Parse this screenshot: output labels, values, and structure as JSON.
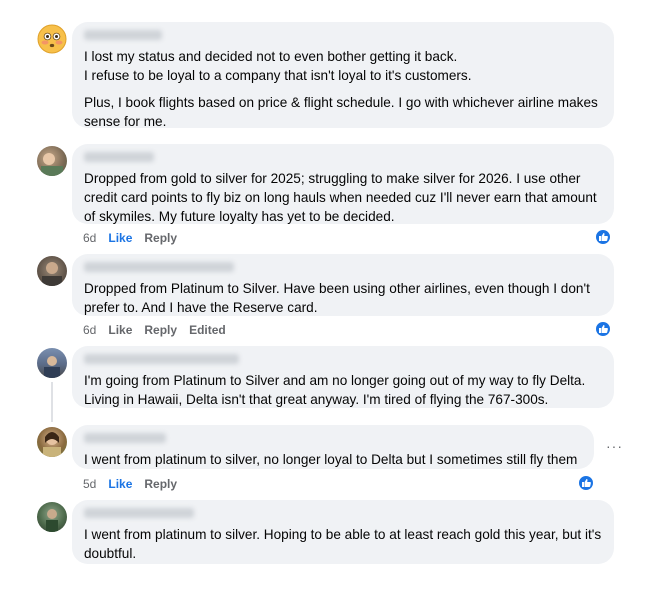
{
  "comments": [
    {
      "paragraphs": [
        "I lost my status and decided not to even bother getting it back.\nI refuse to be loyal to a company that isn't loyal to it's customers.",
        "Plus, I book flights based on price & flight schedule. I go with whichever airline makes sense for me."
      ]
    },
    {
      "text": "Dropped from gold to silver for 2025; struggling to make silver for 2026. I use other credit card points to fly biz on long hauls when needed cuz I'll never earn that amount of skymiles. My future loyalty has yet to be decided.",
      "time": "6d",
      "like": "Like",
      "reply": "Reply"
    },
    {
      "text": "Dropped from Platinum to Silver. Have been using other airlines, even though I don't prefer to. And I have the Reserve card.",
      "time": "6d",
      "like": "Like",
      "reply": "Reply",
      "edited": "Edited"
    },
    {
      "text": "I'm going from Platinum to Silver and am no longer going out of my way to fly Delta. Living in Hawaii, Delta isn't that great anyway. I'm tired of flying the 767-300s."
    },
    {
      "text": "I went from platinum to silver, no longer loyal to Delta but I sometimes still fly them",
      "time": "5d",
      "like": "Like",
      "reply": "Reply",
      "more": "···"
    },
    {
      "text": "I went from platinum to silver. Hoping to be able to at least reach gold this year, but it's doubtful."
    }
  ],
  "colors": {
    "bubble": "#f0f2f5",
    "accent": "#1b74e4",
    "meta": "#65676b"
  },
  "icons": {
    "reaction": "thumbs-up-icon",
    "emoji_avatar": "flushed-face-icon"
  }
}
